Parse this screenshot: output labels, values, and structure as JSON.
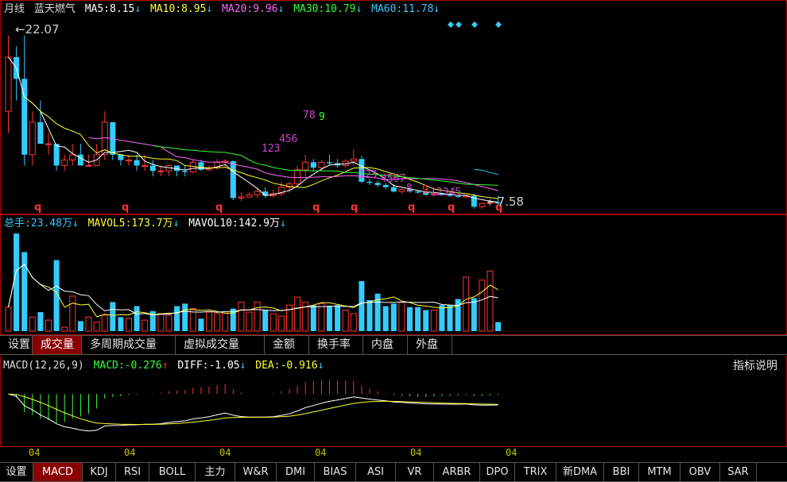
{
  "colors": {
    "up": "#ff3333",
    "down": "#33ccff",
    "ma5": "#ffffff",
    "ma10": "#ffff33",
    "ma20": "#ff66ff",
    "ma30": "#33ff33",
    "ma60": "#33ccff",
    "frame": "#aa0000"
  },
  "price_panel": {
    "period_label": "月线",
    "stock_name": "蓝天燃气",
    "ma5": {
      "label": "MA5:",
      "value": "8.15"
    },
    "ma10": {
      "label": "MA10:",
      "value": "8.95"
    },
    "ma20": {
      "label": "MA20:",
      "value": "9.96"
    },
    "ma30": {
      "label": "MA30:",
      "value": "10.79"
    },
    "ma60": {
      "label": "MA60:",
      "value": "11.78"
    },
    "high_label": "22.07",
    "low_label": "7.58",
    "down_arrow": "↓"
  },
  "volume_panel": {
    "total": {
      "label": "总手:",
      "value": "23.48万"
    },
    "mavol5": {
      "label": "MAVOL5:",
      "value": "173.7万"
    },
    "mavol10": {
      "label": "MAVOL10:",
      "value": "142.9万"
    }
  },
  "tabs_top": [
    "设置",
    "成交量",
    "多周期成交量",
    "虚拟成交量",
    "金额",
    "换手率",
    "内盘",
    "外盘"
  ],
  "tabs_top_active": "成交量",
  "macd_panel": {
    "title": "MACD(12,26,9)",
    "macd": {
      "label": "MACD:",
      "value": "-0.276"
    },
    "diff": {
      "label": "DIFF:",
      "value": "-1.05"
    },
    "dea": {
      "label": "DEA:",
      "value": "-0.916"
    },
    "up_arrow": "↑",
    "explain": "指标说明"
  },
  "x_axis_labels": [
    "04",
    "04",
    "04",
    "04",
    "04",
    "04"
  ],
  "tabs_bottom": [
    "设置",
    "MACD",
    "KDJ",
    "RSI",
    "BOLL",
    "主力",
    "W&R",
    "DMI",
    "BIAS",
    "ASI",
    "VR",
    "ARBR",
    "DPO",
    "TRIX",
    "新DMA",
    "BBI",
    "MTM",
    "OBV",
    "SAR"
  ],
  "tabs_bottom_active": "MACD",
  "chart_data": {
    "type": "candlestick",
    "months": 62,
    "ohlc": [
      [
        15,
        22,
        13,
        20
      ],
      [
        20,
        21,
        16,
        18
      ],
      [
        18,
        22,
        10,
        11
      ],
      [
        11,
        15,
        10,
        14
      ],
      [
        14,
        16,
        12,
        12
      ],
      [
        12,
        13,
        11,
        12
      ],
      [
        12,
        12,
        9.5,
        10
      ],
      [
        10,
        11,
        9.5,
        10.5
      ],
      [
        10.5,
        12,
        10,
        11
      ],
      [
        11,
        12,
        10,
        10
      ],
      [
        10,
        11,
        10,
        10
      ],
      [
        10,
        12,
        10,
        11
      ],
      [
        11,
        15,
        10.5,
        14
      ],
      [
        14,
        14,
        10.5,
        11
      ],
      [
        11,
        11,
        10,
        10.5
      ],
      [
        10.5,
        11,
        10,
        10.5
      ],
      [
        10.5,
        11,
        9.5,
        10
      ],
      [
        10,
        11,
        9.5,
        10
      ],
      [
        10,
        10.5,
        9,
        9.5
      ],
      [
        9.5,
        10,
        9,
        9.5
      ],
      [
        9.5,
        10,
        9,
        10
      ],
      [
        10,
        10,
        9,
        9.5
      ],
      [
        9.5,
        10,
        9,
        9.4
      ],
      [
        9.4,
        10.5,
        9.3,
        10.3
      ],
      [
        10.3,
        10.5,
        9.5,
        9.6
      ],
      [
        9.6,
        10,
        9.5,
        9.8
      ],
      [
        9.8,
        10.6,
        9.6,
        10.3
      ],
      [
        10.3,
        10.6,
        9.8,
        10.4
      ],
      [
        10.4,
        10.5,
        6.8,
        7
      ],
      [
        7,
        7.5,
        6.7,
        7.1
      ],
      [
        7.1,
        7.5,
        7,
        7.3
      ],
      [
        7.3,
        7.8,
        7,
        7.6
      ],
      [
        7.6,
        8,
        7,
        7.2
      ],
      [
        7.2,
        7.8,
        7,
        7.4
      ],
      [
        7.4,
        8.5,
        7.2,
        8
      ],
      [
        8,
        8.5,
        7.5,
        8.3
      ],
      [
        8.3,
        10,
        8,
        9.6
      ],
      [
        9.6,
        11,
        9,
        10.3
      ],
      [
        10.3,
        10.6,
        9.5,
        9.8
      ],
      [
        9.8,
        10.5,
        9.5,
        10.3
      ],
      [
        10.3,
        11,
        10,
        10.2
      ],
      [
        10.2,
        10.6,
        9.8,
        10
      ],
      [
        10,
        10.6,
        9.8,
        10.4
      ],
      [
        10.4,
        11.5,
        10,
        10.6
      ],
      [
        10.6,
        10.9,
        8.4,
        8.5
      ],
      [
        8.5,
        8.8,
        8.2,
        8.4
      ],
      [
        8.4,
        8.6,
        8,
        8.2
      ],
      [
        8.2,
        8.4,
        7.8,
        8
      ],
      [
        8,
        8.3,
        7.5,
        7.6
      ],
      [
        7.6,
        7.9,
        7.4,
        7.8
      ],
      [
        7.8,
        7.9,
        7.5,
        7.6
      ],
      [
        7.6,
        7.7,
        7.4,
        7.5
      ],
      [
        7.5,
        7.6,
        7.2,
        7.3
      ],
      [
        7.3,
        7.5,
        7.1,
        7.4
      ],
      [
        7.4,
        7.5,
        7.2,
        7.3
      ],
      [
        7.3,
        7.5,
        7.1,
        7.2
      ],
      [
        7.2,
        7.3,
        7,
        7.1
      ],
      [
        7.1,
        7.3,
        7,
        7.2
      ],
      [
        7.2,
        7.4,
        6,
        6.2
      ],
      [
        6.2,
        6.6,
        6,
        6.5
      ],
      [
        6.5,
        6.7,
        6.3,
        6.6
      ],
      [
        6.6,
        7.2,
        6.4,
        6.5
      ]
    ],
    "volume": [
      48,
      195,
      158,
      28,
      38,
      22,
      142,
      8,
      70,
      20,
      28,
      18,
      32,
      58,
      28,
      26,
      50,
      22,
      40,
      35,
      32,
      50,
      55,
      45,
      25,
      38,
      35,
      36,
      45,
      58,
      38,
      58,
      42,
      35,
      30,
      52,
      68,
      58,
      52,
      55,
      50,
      52,
      42,
      35,
      100,
      62,
      75,
      50,
      55,
      58,
      48,
      48,
      42,
      42,
      52,
      52,
      64,
      108,
      66,
      102,
      120,
      18
    ],
    "y_price_range": [
      6,
      23
    ],
    "y_volume_range": [
      0,
      200
    ]
  }
}
